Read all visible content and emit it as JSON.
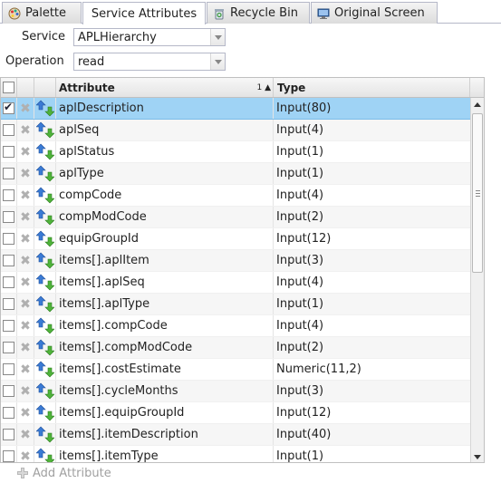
{
  "tabs": [
    {
      "label": "Palette",
      "icon": "palette-icon"
    },
    {
      "label": "Service Attributes",
      "icon": ""
    },
    {
      "label": "Recycle Bin",
      "icon": "recycle-bin-icon"
    },
    {
      "label": "Original Screen",
      "icon": "monitor-icon"
    }
  ],
  "active_tab": "Service Attributes",
  "form": {
    "service_label": "Service",
    "service_value": "APLHierarchy",
    "operation_label": "Operation",
    "operation_value": "read"
  },
  "grid": {
    "headers": {
      "attribute": "Attribute",
      "sort_indicator": "1 ▲",
      "type": "Type"
    },
    "rows": [
      {
        "attribute": "aplDescription",
        "type": "Input(80)",
        "checked": true,
        "selected": true
      },
      {
        "attribute": "aplSeq",
        "type": "Input(4)",
        "checked": false,
        "selected": false
      },
      {
        "attribute": "aplStatus",
        "type": "Input(1)",
        "checked": false,
        "selected": false
      },
      {
        "attribute": "aplType",
        "type": "Input(1)",
        "checked": false,
        "selected": false
      },
      {
        "attribute": "compCode",
        "type": "Input(4)",
        "checked": false,
        "selected": false
      },
      {
        "attribute": "compModCode",
        "type": "Input(2)",
        "checked": false,
        "selected": false
      },
      {
        "attribute": "equipGroupId",
        "type": "Input(12)",
        "checked": false,
        "selected": false
      },
      {
        "attribute": "items[].aplItem",
        "type": "Input(3)",
        "checked": false,
        "selected": false
      },
      {
        "attribute": "items[].aplSeq",
        "type": "Input(4)",
        "checked": false,
        "selected": false
      },
      {
        "attribute": "items[].aplType",
        "type": "Input(1)",
        "checked": false,
        "selected": false
      },
      {
        "attribute": "items[].compCode",
        "type": "Input(4)",
        "checked": false,
        "selected": false
      },
      {
        "attribute": "items[].compModCode",
        "type": "Input(2)",
        "checked": false,
        "selected": false
      },
      {
        "attribute": "items[].costEstimate",
        "type": "Numeric(11,2)",
        "checked": false,
        "selected": false
      },
      {
        "attribute": "items[].cycleMonths",
        "type": "Input(3)",
        "checked": false,
        "selected": false
      },
      {
        "attribute": "items[].equipGroupId",
        "type": "Input(12)",
        "checked": false,
        "selected": false
      },
      {
        "attribute": "items[].itemDescription",
        "type": "Input(40)",
        "checked": false,
        "selected": false
      },
      {
        "attribute": "items[].itemType",
        "type": "Input(1)",
        "checked": false,
        "selected": false
      }
    ]
  },
  "footer": {
    "add_label": "Add Attribute",
    "add_icon": "add-icon"
  },
  "colors": {
    "selected_row": "#9fd3f5",
    "arrow_up": "#3a7bd5",
    "arrow_down": "#4fb33a"
  }
}
